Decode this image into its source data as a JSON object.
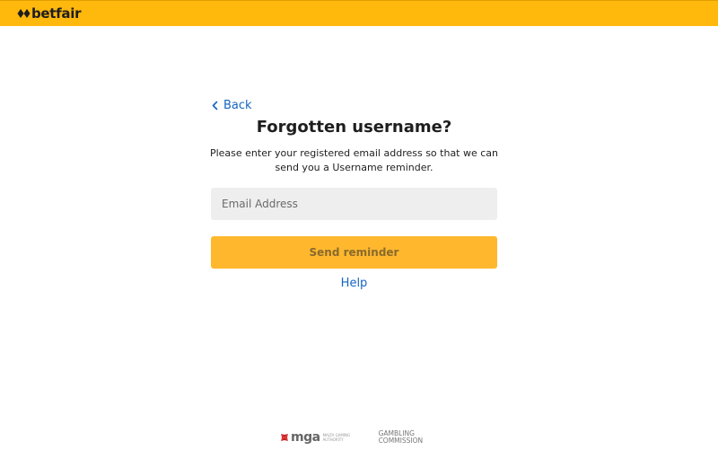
{
  "header": {
    "brand": "betfair",
    "bg_color": "#ffb80c",
    "logo_icon": "betfair-diamond-icon"
  },
  "nav": {
    "back_label": "Back",
    "back_icon": "chevron-left-icon"
  },
  "form": {
    "title": "Forgotten username?",
    "description": "Please enter your registered email address so that we can send you a Username reminder.",
    "email_placeholder": "Email Address",
    "email_value": "",
    "submit_label": "Send reminder",
    "help_label": "Help"
  },
  "footer": {
    "mga_label": "mga",
    "mga_subtext": "MALTA GAMING AUTHORITY",
    "gc_line1": "GAMBLING",
    "gc_line2": "COMMISSION"
  },
  "colors": {
    "accent": "#ffb80c",
    "button": "#ffb82e",
    "link": "#1565c0",
    "input_bg": "#eeeeee"
  }
}
